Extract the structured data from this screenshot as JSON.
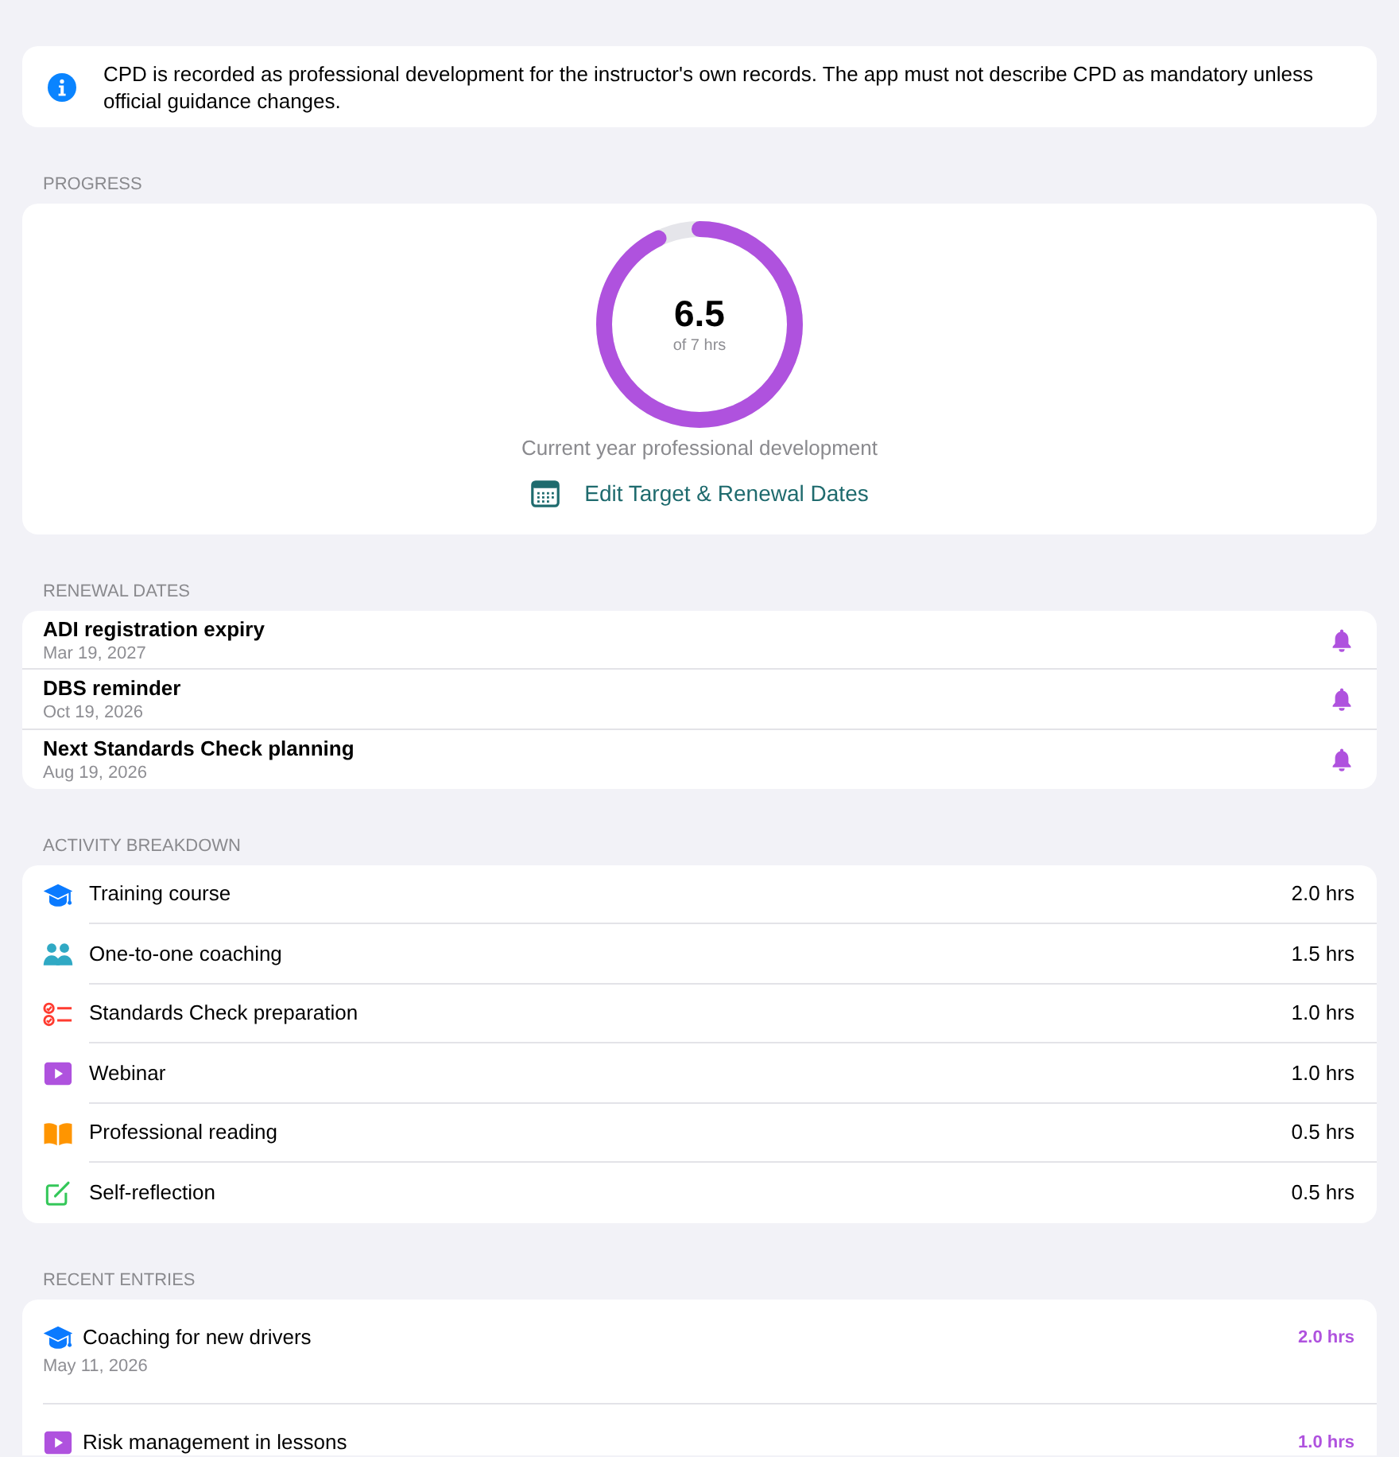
{
  "notice": {
    "text": "CPD is recorded as professional development for the instructor's own records. The app must not describe CPD as mandatory unless official guidance changes."
  },
  "progress": {
    "heading": "PROGRESS",
    "value": "6.5",
    "target": "of 7 hrs",
    "level": 0.929,
    "caption": "Current year professional development",
    "action": "Edit Target & Renewal Dates"
  },
  "renewal_dates": {
    "heading": "RENEWAL DATES",
    "items": [
      {
        "title": "ADI registration expiry",
        "date": "Mar 19, 2027",
        "reminder": true
      },
      {
        "title": "DBS reminder",
        "date": "Oct 19, 2026",
        "reminder": true
      },
      {
        "title": "Next Standards Check planning",
        "date": "Aug 19, 2026",
        "reminder": true
      }
    ]
  },
  "activity_breakdown": {
    "heading": "ACTIVITY BREAKDOWN",
    "items": [
      {
        "label": "Training course",
        "hours": "2.0 hrs",
        "kind": "course",
        "color": "#0a7aff"
      },
      {
        "label": "One-to-one coaching",
        "hours": "1.5 hrs",
        "kind": "coaching",
        "color": "#30a9c4"
      },
      {
        "label": "Standards Check preparation",
        "hours": "1.0 hrs",
        "kind": "checklist",
        "color": "#ff3b30"
      },
      {
        "label": "Webinar",
        "hours": "1.0 hrs",
        "kind": "webinar",
        "color": "#af52de"
      },
      {
        "label": "Professional reading",
        "hours": "0.5 hrs",
        "kind": "reading",
        "color": "#ff9500"
      },
      {
        "label": "Self-reflection",
        "hours": "0.5 hrs",
        "kind": "reflection",
        "color": "#34c759"
      }
    ]
  },
  "recent_entries": {
    "heading": "RECENT ENTRIES",
    "items": [
      {
        "title": "Coaching for new drivers",
        "date": "May 11, 2026",
        "hours": "2.0 hrs",
        "kind": "course",
        "color": "#0a7aff"
      },
      {
        "title": "Risk management in lessons",
        "hours": "1.0 hrs",
        "kind": "webinar",
        "color": "#af52de"
      }
    ]
  }
}
